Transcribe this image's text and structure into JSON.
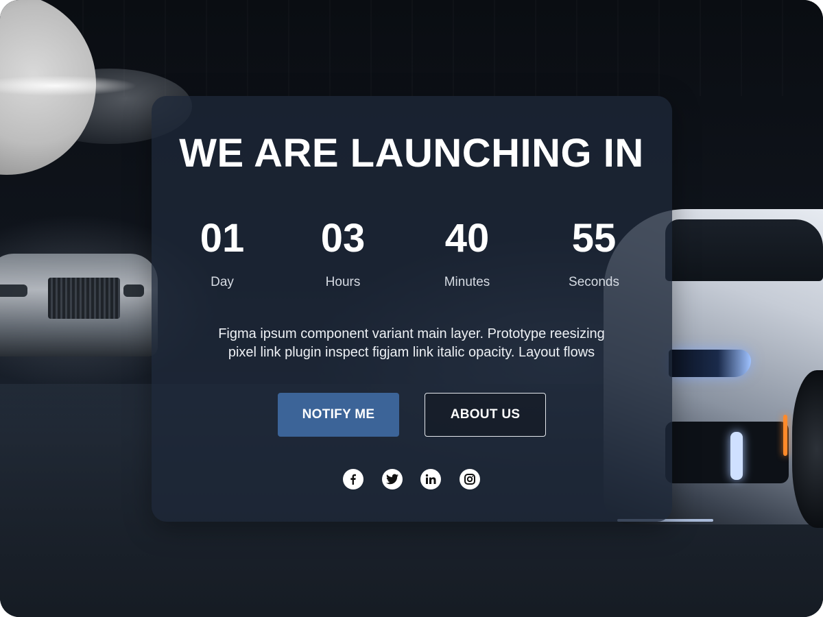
{
  "hero": {
    "title": "WE ARE LAUNCHING IN",
    "countdown": [
      {
        "value": "01",
        "label": "Day"
      },
      {
        "value": "03",
        "label": "Hours"
      },
      {
        "value": "40",
        "label": "Minutes"
      },
      {
        "value": "55",
        "label": "Seconds"
      }
    ],
    "description_line1": "Figma ipsum component variant main layer. Prototype reesizing",
    "description_line2": "pixel link plugin inspect figjam link italic opacity. Layout flows"
  },
  "buttons": {
    "notify_label": "NOTIFY ME",
    "about_label": "ABOUT US"
  },
  "social": [
    {
      "icon": "facebook-icon"
    },
    {
      "icon": "twitter-icon"
    },
    {
      "icon": "linkedin-icon"
    },
    {
      "icon": "instagram-icon"
    }
  ],
  "colors": {
    "card_bg": "#1e2838",
    "primary_button": "#3c6498",
    "text": "#ffffff"
  }
}
